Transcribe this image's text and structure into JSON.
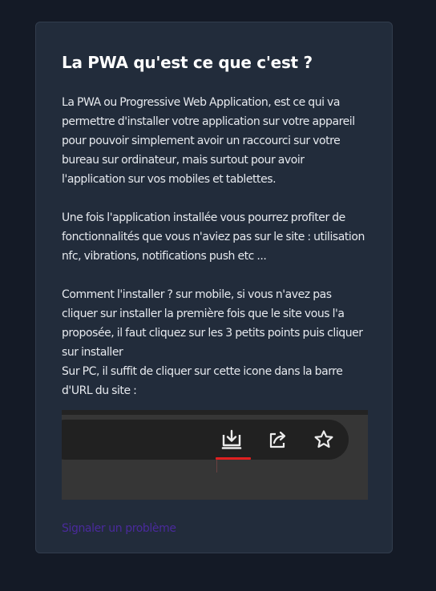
{
  "card": {
    "title": "La PWA qu'est ce que c'est ?",
    "paragraphs": [
      "La PWA ou Progressive Web Application, est ce qui va permettre d'installer votre application sur votre appareil pour pouvoir simplement avoir un raccourci sur votre bureau sur ordinateur, mais surtout pour avoir l'application sur vos mobiles et tablettes.",
      "Une fois l'application installée vous pourrez profiter de fonctionnalités que vous n'aviez pas sur le site : utilisation nfc, vibrations, notifications push etc ...",
      "Comment l'installer ? sur mobile, si vous n'avez pas cliquer sur installer la première fois que le site vous l'a proposée, il faut cliquez sur les 3 petits points puis cliquer sur installer",
      "Sur PC, il suffit de cliquer sur cette icone dans la barre d'URL du site :"
    ],
    "screenshot_icons": [
      "install-app-icon",
      "share-icon",
      "star-icon"
    ],
    "report_link": "Signaler un problème"
  },
  "colors": {
    "page_background": "#141a26",
    "card_background": "#222c3b",
    "card_border": "#323d4d",
    "title": "#ffffff",
    "body_text": "#e6e9ee",
    "link": "#4a2a9c",
    "install_underline": "#e02020"
  }
}
